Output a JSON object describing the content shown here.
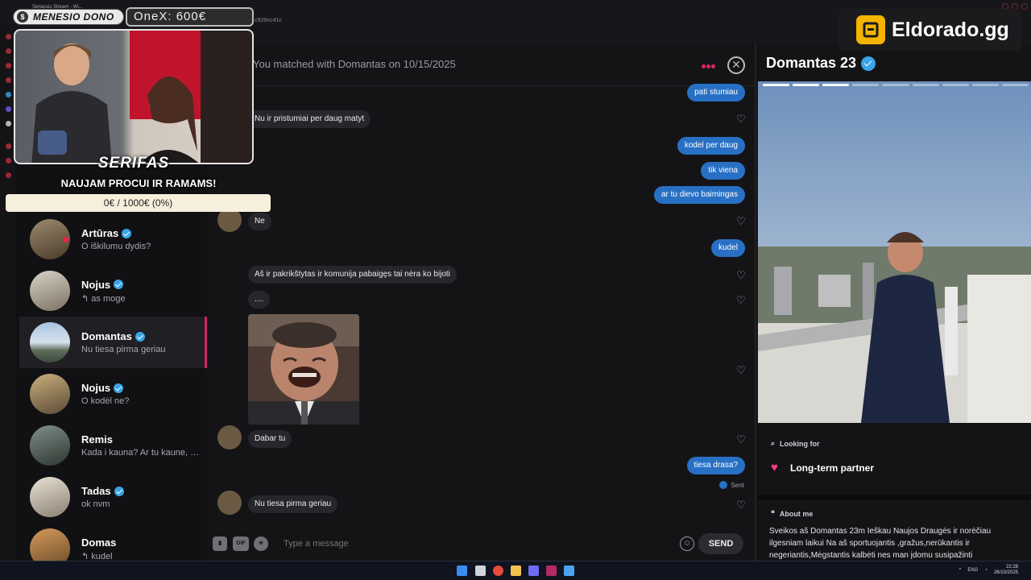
{
  "browser": {
    "tab_title": "Seriassis Stream - Wi...",
    "url_fragment": "c926ec41c"
  },
  "overlay": {
    "donor_name": "MENESIO DONO",
    "onex_text": "OneX: 600€",
    "streamer_title": "SERIFAS",
    "streamer_sub": "NAUJAM PROCUI IR RAMAMS!",
    "goal_text": "0€ / 1000€ (0%)",
    "goal_fraction": 0.0,
    "sponsor_brand": "Eldorado.gg"
  },
  "conversations": [
    {
      "name": "Artūras",
      "verified": true,
      "preview": "O iškilumu dydis?",
      "online": true
    },
    {
      "name": "Nojus",
      "verified": true,
      "preview": "↰ as moge",
      "online": false
    },
    {
      "name": "Domantas",
      "verified": true,
      "preview": "Nu tiesa pirma geriau",
      "online": false,
      "active": true
    },
    {
      "name": "Nojus",
      "verified": true,
      "preview": "O kodėl ne?",
      "online": false
    },
    {
      "name": "Remis",
      "verified": false,
      "preview": "Kada i kauna? Ar tu kaune, ne...",
      "online": false
    },
    {
      "name": "Tadas",
      "verified": true,
      "preview": "ok nvm",
      "online": false
    },
    {
      "name": "Domas",
      "verified": false,
      "preview": "↰ kudel",
      "online": false
    }
  ],
  "chat": {
    "match_text": "You matched with Domantas on 10/15/2025",
    "messages": [
      {
        "dir": "out",
        "text": "pati stumiau"
      },
      {
        "dir": "in",
        "text": "Nu ir pristumiai per daug  matyt"
      },
      {
        "dir": "out",
        "text": "kodel per daug"
      },
      {
        "dir": "out",
        "text": "tik viena"
      },
      {
        "dir": "out",
        "text": "ar tu dievo baimingas"
      },
      {
        "dir": "in",
        "text": "Ne"
      },
      {
        "dir": "out",
        "text": "kudel"
      },
      {
        "dir": "in",
        "text": "Aš ir pakrikštytas ir komunija pabaigęs tai nėra ko bijoti"
      },
      {
        "dir": "in",
        "text": "...."
      },
      {
        "dir": "in",
        "text": "Dabar  tu"
      },
      {
        "dir": "out",
        "text": "tiesa drasa?"
      },
      {
        "dir": "in",
        "text": "Nu tiesa pirma geriau"
      }
    ],
    "sent_label": "Sent",
    "composer_placeholder": "Type a message",
    "gif_label": "GIF",
    "send_label": "SEND"
  },
  "profile": {
    "name_age": "Domantas 23",
    "looking_for_label": "Looking for",
    "looking_for_value": "Long-term partner",
    "about_label": "About me",
    "about_text": "Sveikos aš Domantas 23m Ieškau Naujos Draugės ir norėčiau ilgesniam laikui Na aš sportuojantis ,gražus,nerūkantis ir negeriantis,Mėgstantis kalbėti nes man įdomu susipažinti"
  },
  "taskbar": {
    "lang": "ENG",
    "time": "22:28",
    "date": "26/10/2025"
  },
  "colors": {
    "accent": "#d0245a",
    "bubble_out": "#2870c4",
    "bubble_in": "#26262c",
    "verified": "#3aa5e8",
    "brand": "#f5b400"
  }
}
